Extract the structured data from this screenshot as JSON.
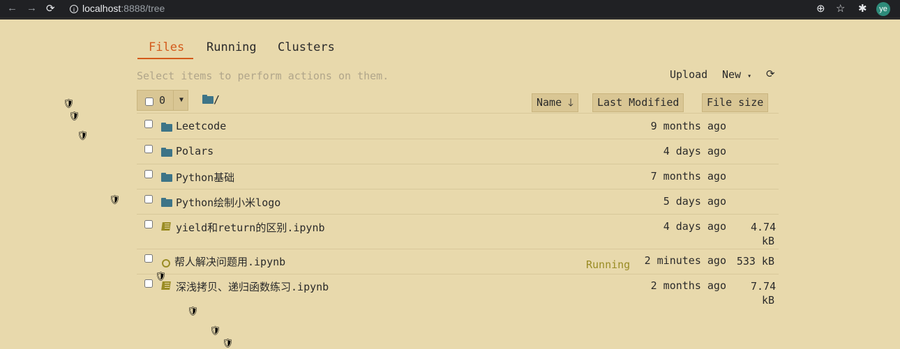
{
  "browser": {
    "url_host": "localhost",
    "url_path": ":8888/tree",
    "profile_initials": "ye"
  },
  "tabs": [
    {
      "label": "Files",
      "active": true
    },
    {
      "label": "Running",
      "active": false
    },
    {
      "label": "Clusters",
      "active": false
    }
  ],
  "toolbar": {
    "hint": "Select items to perform actions on them.",
    "upload_label": "Upload",
    "new_label": "New",
    "selected_count": "0",
    "root_path": "/"
  },
  "columns": {
    "name": "Name",
    "last_modified": "Last Modified",
    "file_size": "File size"
  },
  "files": [
    {
      "type": "folder",
      "name": "Leetcode",
      "modified": "9 months ago",
      "size": ""
    },
    {
      "type": "folder",
      "name": "Polars",
      "modified": "4 days ago",
      "size": ""
    },
    {
      "type": "folder",
      "name": "Python基础",
      "modified": "7 months ago",
      "size": ""
    },
    {
      "type": "folder",
      "name": "Python绘制小米logo",
      "modified": "5 days ago",
      "size": ""
    },
    {
      "type": "notebook",
      "name": "yield和return的区别.ipynb",
      "modified": "4 days ago",
      "size": "4.74 kB"
    },
    {
      "type": "notebook-running",
      "name": "帮人解决问题用.ipynb",
      "modified": "2 minutes ago",
      "size": "533 kB",
      "status": "Running"
    },
    {
      "type": "notebook",
      "name": "深浅拷贝、递归函数练习.ipynb",
      "modified": "2 months ago",
      "size": "7.74 kB"
    }
  ],
  "colors": {
    "background": "#e8d9ac",
    "accent": "#d35a1b",
    "folder": "#3d7487",
    "notebook": "#9a8c24"
  }
}
